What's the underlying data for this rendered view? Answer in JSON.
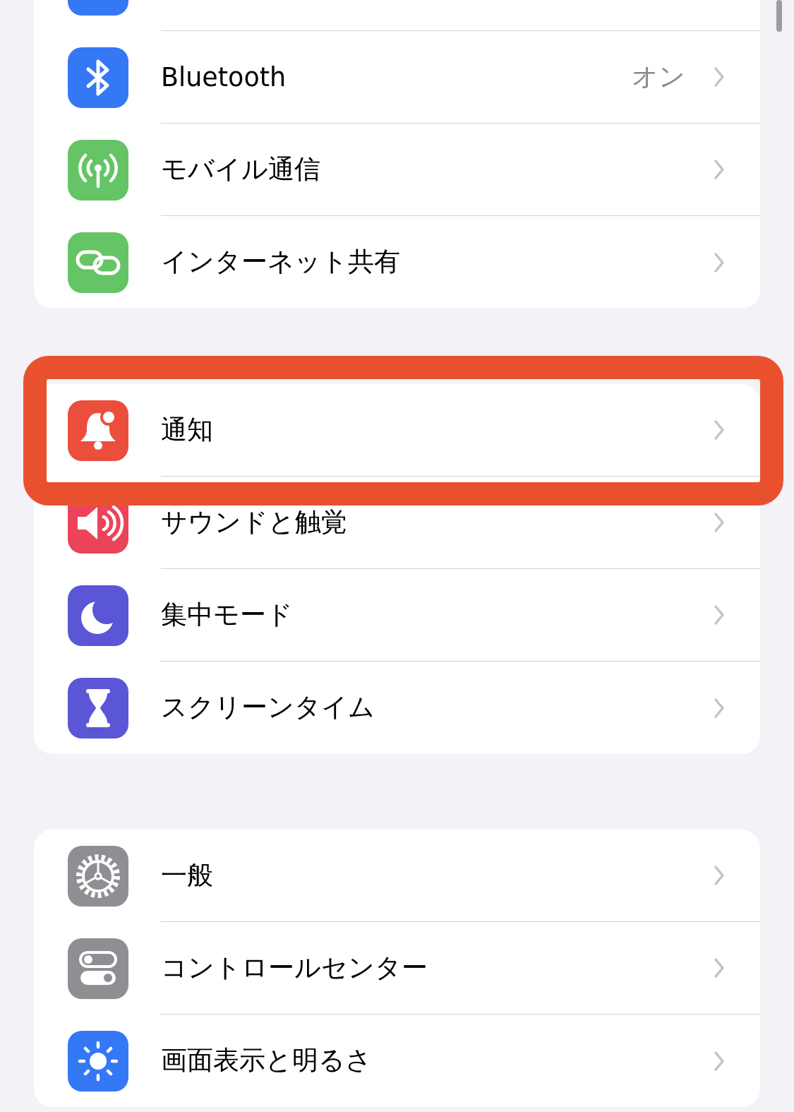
{
  "groups": [
    {
      "rows": [
        {
          "kind": "unknown",
          "color": "#3478f6"
        },
        {
          "kind": "bluetooth",
          "color": "#3478f6",
          "label": "Bluetooth",
          "value": "オン",
          "highlighted": false
        },
        {
          "kind": "antenna",
          "color": "#65c466",
          "label": "モバイル通信",
          "highlighted": false
        },
        {
          "kind": "link",
          "color": "#65c466",
          "label": "インターネット共有",
          "highlighted": false
        }
      ]
    },
    {
      "rows": [
        {
          "kind": "bell",
          "color": "#eb4e3d",
          "label": "通知",
          "highlighted": true
        },
        {
          "kind": "speaker",
          "color": "#eb445a",
          "label": "サウンドと触覚",
          "highlighted": false
        },
        {
          "kind": "moon",
          "color": "#5a56d6",
          "label": "集中モード",
          "highlighted": false
        },
        {
          "kind": "hourglass",
          "color": "#5a56d6",
          "label": "スクリーンタイム",
          "highlighted": false
        }
      ]
    },
    {
      "rows": [
        {
          "kind": "gear",
          "color": "#8e8e93",
          "label": "一般",
          "highlighted": false
        },
        {
          "kind": "toggles",
          "color": "#8e8e93",
          "label": "コントロールセンター",
          "highlighted": false
        },
        {
          "kind": "sun",
          "color": "#3478f6",
          "label": "画面表示と明るさ",
          "highlighted": false
        }
      ]
    }
  ]
}
